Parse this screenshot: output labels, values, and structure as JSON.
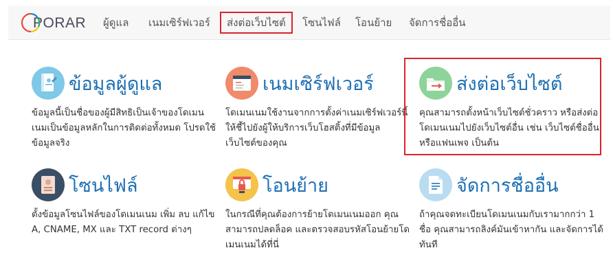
{
  "brand": {
    "logo_text": "PORAR"
  },
  "nav": {
    "items": [
      {
        "label": "ผู้ดูแล"
      },
      {
        "label": "เนมเซิร์ฟเวอร์"
      },
      {
        "label": "ส่งต่อเว็บไซต์"
      },
      {
        "label": "โซนไฟล์"
      },
      {
        "label": "โอนย้าย"
      },
      {
        "label": "จัดการชื่ออื่น"
      }
    ],
    "active_index": 2
  },
  "cards": [
    {
      "title": "ข้อมูลผู้ดูแล",
      "icon": "contact-book-icon",
      "icon_color": "#7fc8e8",
      "description": "ข้อมูลนี้เป็นชื่อของผู้มีสิทธิเป็นเจ้าของโดเมนเนมเป็นข้อมูลหลักในการติดต่อทั้งหมด โปรดใช้ข้อมูลจริง"
    },
    {
      "title": "เนมเซิร์ฟเวอร์",
      "icon": "browser-window-icon",
      "icon_color": "#f08a6a",
      "description": "โดเมนเนมใช้งานจากการตั้งค่าเนมเซิร์ฟเวอร์นี้ ให้ชี้ไปยังผู้ให้บริการเว็บโฮสติ้งที่มีข้อมูลเว็บไซต์ของคุณ"
    },
    {
      "title": "ส่งต่อเว็บไซต์",
      "icon": "folder-forward-icon",
      "icon_color": "#8ed49a",
      "description": "คุณสามารถตั้งหน้าเว็บไซต์ชั่วคราว หรือส่งต่อโดเมนเนมไปยังเว็บไซต์อื่น เช่น เว็บไซต์ชื่ออื่น หรือแฟนเพจ เป็นต้น"
    },
    {
      "title": "โซนไฟล์",
      "icon": "zone-file-icon",
      "icon_color": "#3a4e66",
      "description": "ตั้งข้อมูลโซนไฟล์ของโดเมนเนม เพิ่ม ลบ แก้ไข A, CNAME, MX และ TXT record ต่างๆ"
    },
    {
      "title": "โอนย้าย",
      "icon": "lock-screen-icon",
      "icon_color": "#f5c24a",
      "description": "ในกรณีที่คุณต้องการย้ายโดเมนเนมออก คุณสามารถปลดล็อค และตรวจสอบรหัสโอนย้ายโดเมนเนมได้ที่นี่"
    },
    {
      "title": "จัดการชื่ออื่น",
      "icon": "document-list-icon",
      "icon_color": "#b9dcf0",
      "description": "ถ้าคุณจดทะเบียนโดเมนเนมกับเรามากกว่า 1 ชื่อ คุณสามารถลิงค์มันเข้าหากัน และจัดการได้ทันที"
    }
  ]
}
